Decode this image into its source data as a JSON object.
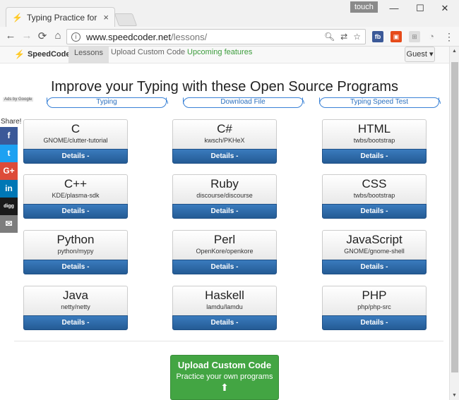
{
  "browser": {
    "tab_title": "Typing Practice for Programmers",
    "tab_close": "×",
    "touch_label": "touch",
    "min": "—",
    "max": "☐",
    "close": "✕",
    "back": "←",
    "forward": "→",
    "reload": "⟳",
    "home": "⌂",
    "url_host": "www.speedcoder.net",
    "url_path": "/lessons/",
    "menu": "⋮"
  },
  "navbar": {
    "brand": "SpeedCoder",
    "lessons": "Lessons",
    "upload": "Upload Custom Code",
    "upcoming": "Upcoming features",
    "guest": "Guest"
  },
  "main": {
    "headline": "Improve your Typing with these Open Source Programs",
    "ads_label": "Ads by Google",
    "pills": [
      "Typing",
      "Download File",
      "Typing Speed Test"
    ],
    "share_label": "Share!",
    "details_label": "Details -",
    "upload_title": "Upload Custom Code",
    "upload_sub": "Practice your own programs"
  },
  "lessons": [
    {
      "lang": "C",
      "repo": "GNOME/clutter-tutorial"
    },
    {
      "lang": "C#",
      "repo": "kwsch/PKHeX"
    },
    {
      "lang": "HTML",
      "repo": "twbs/bootstrap"
    },
    {
      "lang": "C++",
      "repo": "KDE/plasma-sdk"
    },
    {
      "lang": "Ruby",
      "repo": "discourse/discourse"
    },
    {
      "lang": "CSS",
      "repo": "twbs/bootstrap"
    },
    {
      "lang": "Python",
      "repo": "python/mypy"
    },
    {
      "lang": "Perl",
      "repo": "OpenKore/openkore"
    },
    {
      "lang": "JavaScript",
      "repo": "GNOME/gnome-shell"
    },
    {
      "lang": "Java",
      "repo": "netty/netty"
    },
    {
      "lang": "Haskell",
      "repo": "lamdu/lamdu"
    },
    {
      "lang": "PHP",
      "repo": "php/php-src"
    }
  ],
  "share_buttons": [
    {
      "name": "facebook-icon",
      "glyph": "f",
      "color": "#3b5998"
    },
    {
      "name": "twitter-icon",
      "glyph": "t",
      "color": "#1da1f2"
    },
    {
      "name": "google-plus-icon",
      "glyph": "G+",
      "color": "#dd4b39"
    },
    {
      "name": "linkedin-icon",
      "glyph": "in",
      "color": "#0077b5"
    },
    {
      "name": "digg-icon",
      "glyph": "digg",
      "color": "#1a1a1a"
    },
    {
      "name": "email-icon",
      "glyph": "✉",
      "color": "#7d7d7d"
    }
  ],
  "colors": {
    "accent_blue": "#2a6fbe",
    "details_button": "#245b95",
    "upload_green": "#43a543",
    "upcoming_green": "#3c9c3c"
  }
}
